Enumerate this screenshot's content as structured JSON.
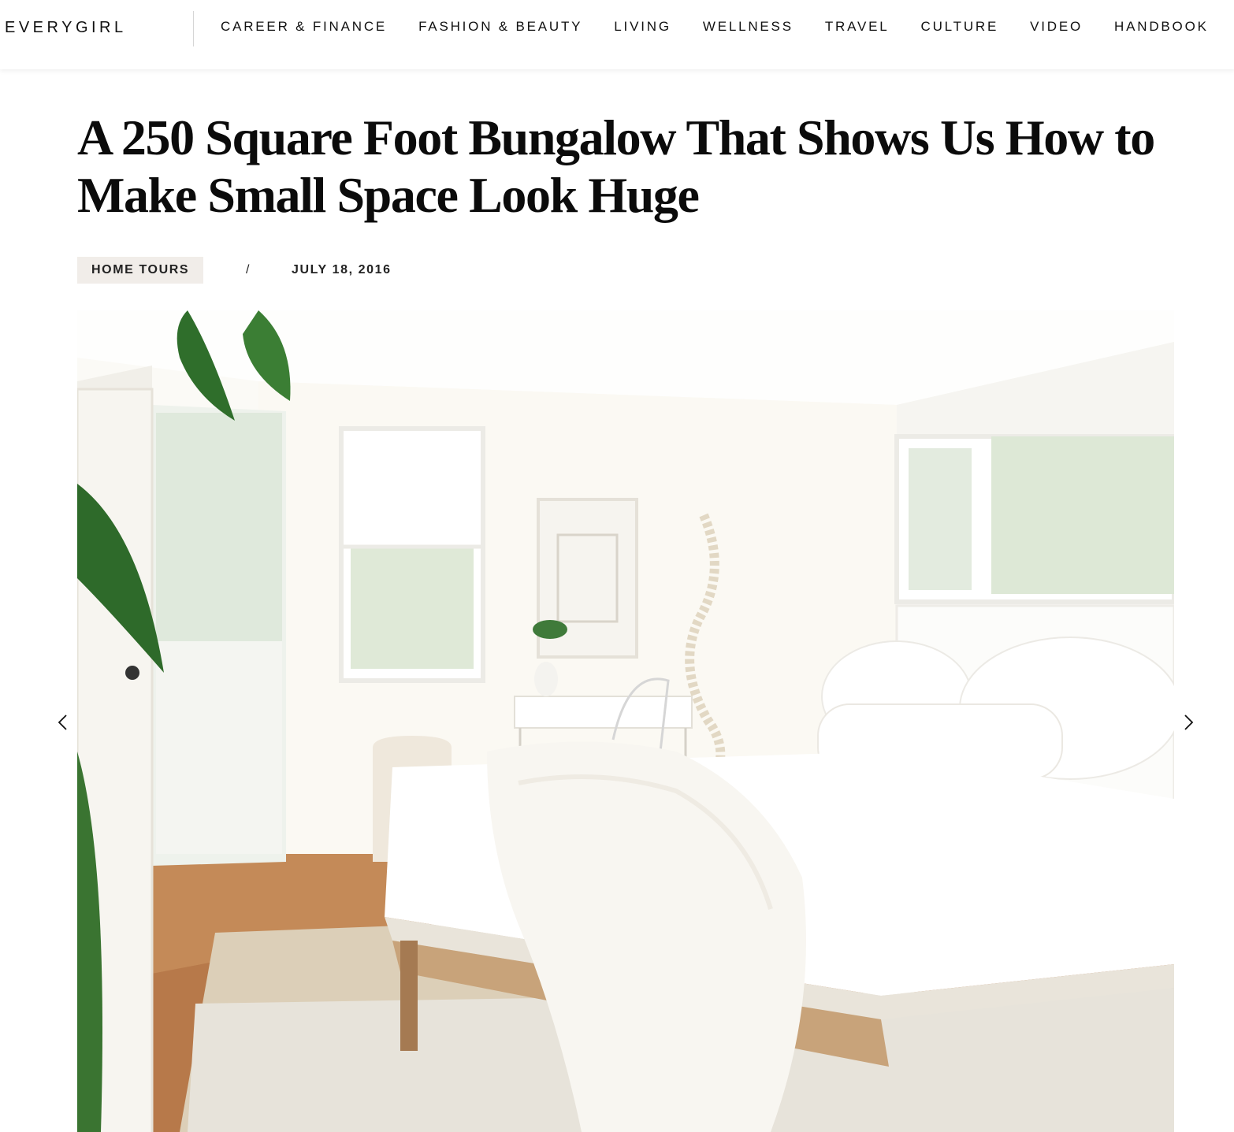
{
  "header": {
    "logo_text": "EVERYGIRL",
    "nav": [
      {
        "label": "CAREER & FINANCE"
      },
      {
        "label": "FASHION & BEAUTY"
      },
      {
        "label": "LIVING"
      },
      {
        "label": "WELLNESS"
      },
      {
        "label": "TRAVEL"
      },
      {
        "label": "CULTURE"
      },
      {
        "label": "VIDEO"
      },
      {
        "label": "HANDBOOK"
      }
    ]
  },
  "article": {
    "title": "A 250 Square Foot Bungalow That Shows Us How to Make Small Space Look Huge",
    "category": "HOME TOURS",
    "separator": "/",
    "date": "JULY 18, 2016"
  },
  "slideshow": {
    "prev_icon": "chevron-left-icon",
    "next_icon": "chevron-right-icon",
    "image_subject": "bright white bedroom"
  },
  "colors": {
    "tag_background": "#f1ede9",
    "text": "#111111",
    "floor": "#b7794a"
  }
}
